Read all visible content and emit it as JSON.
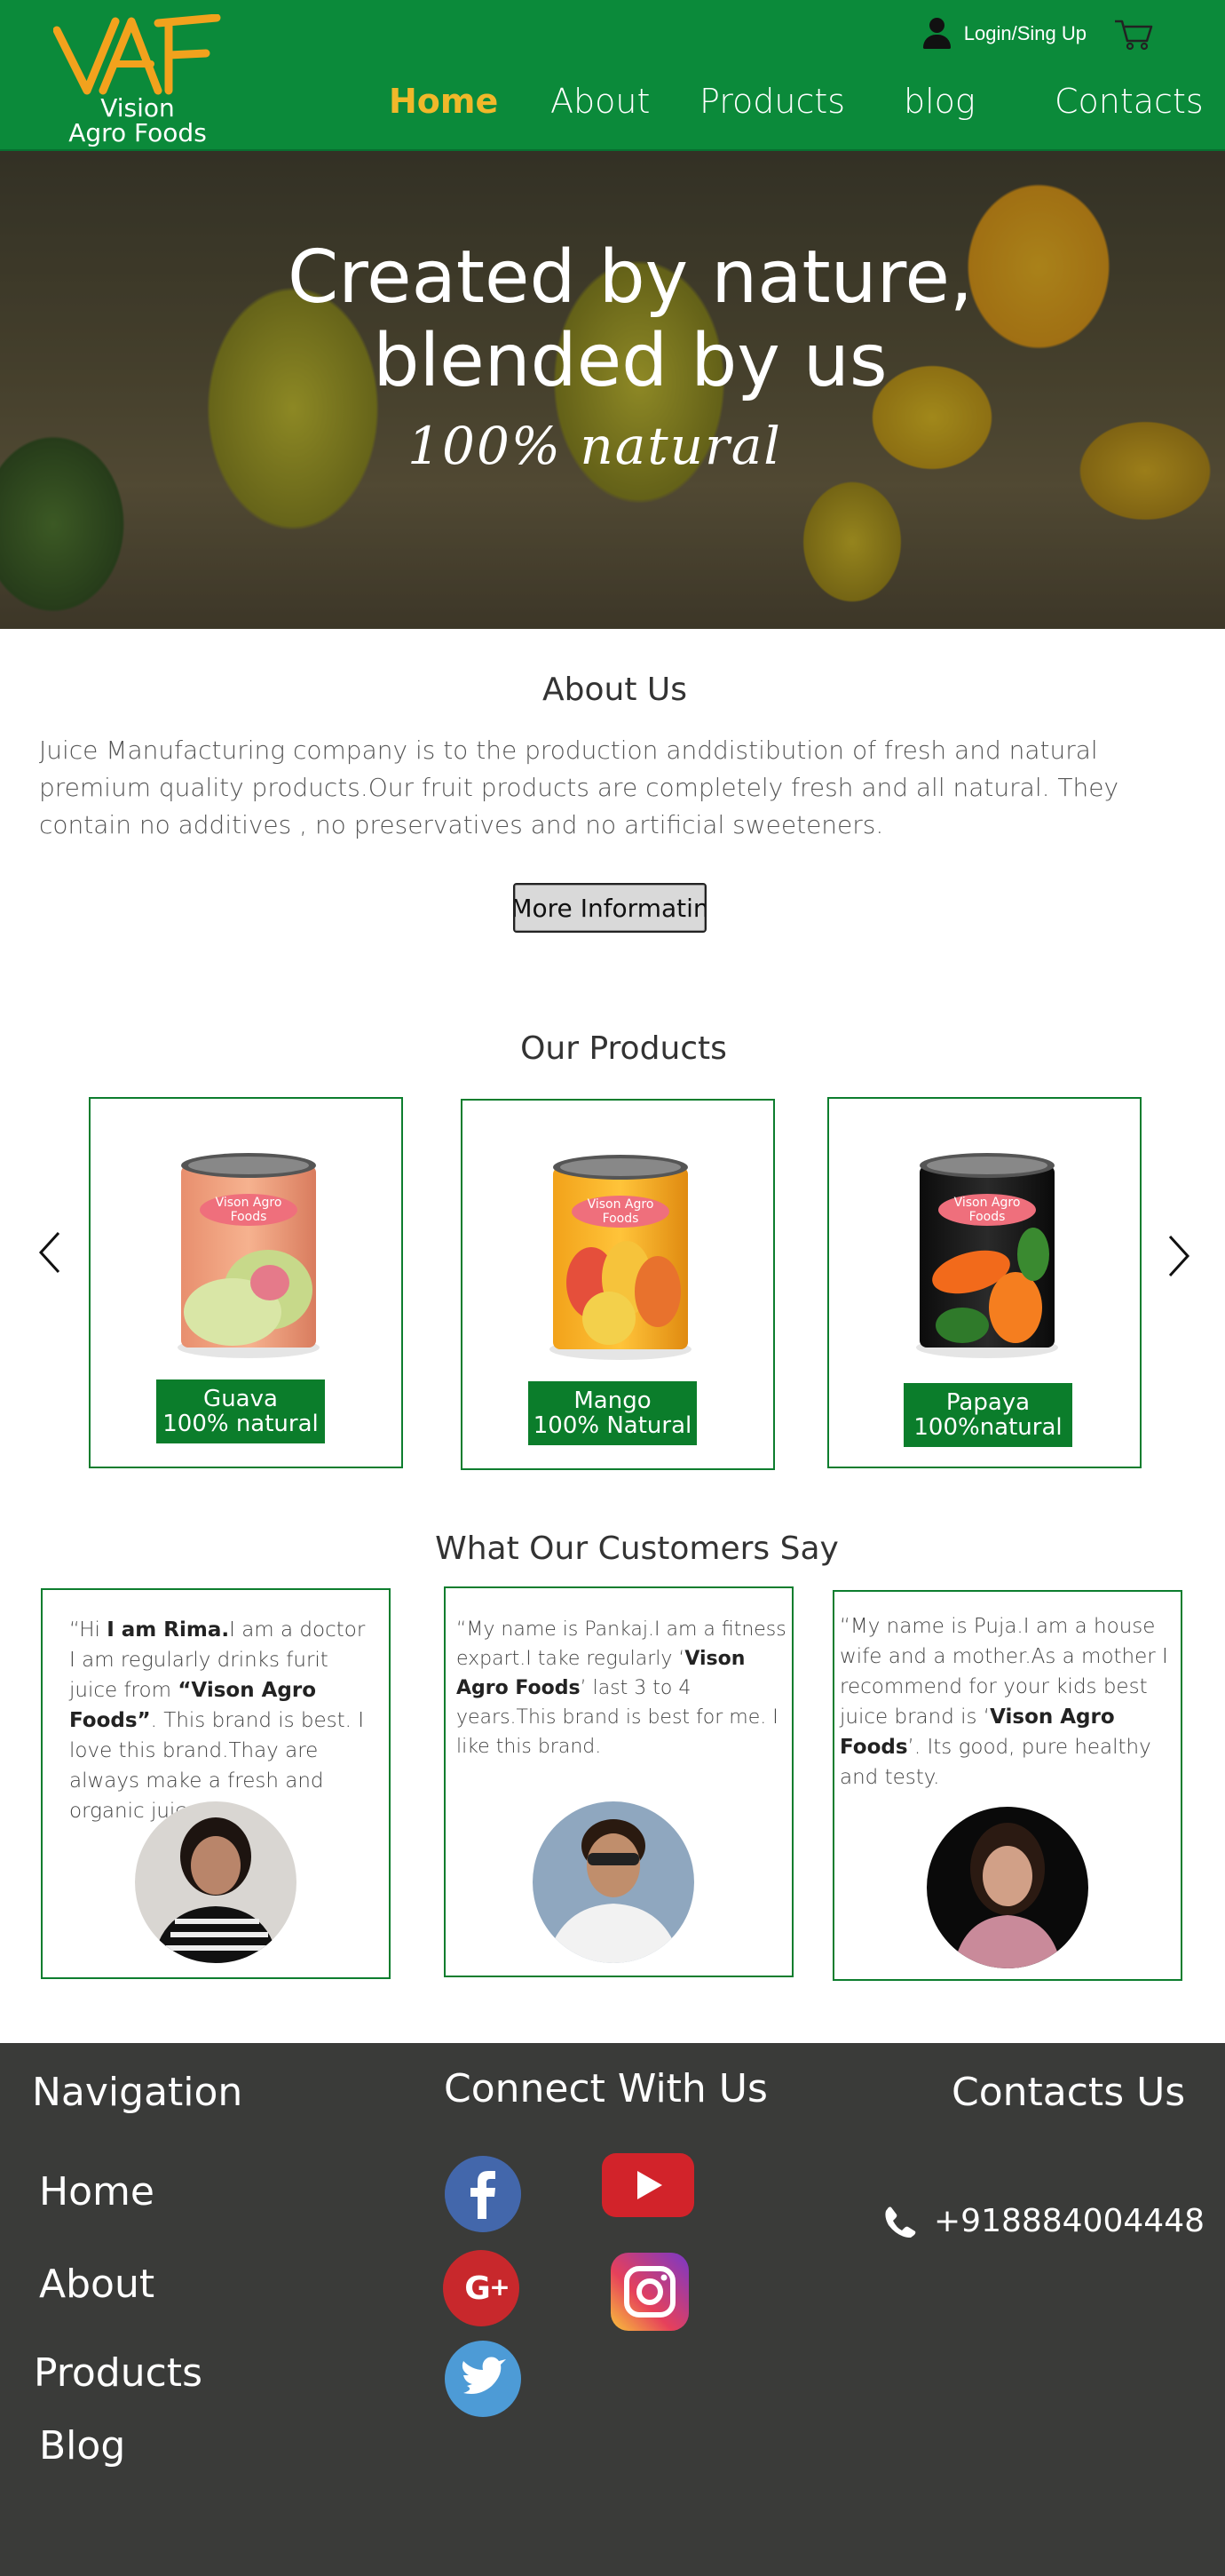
{
  "header": {
    "logo_text_line1": "Vision",
    "logo_text_line2": "Agro Foods",
    "login_label": "Login/Sing Up",
    "nav": [
      {
        "label": "Home",
        "active": true
      },
      {
        "label": "About",
        "active": false
      },
      {
        "label": "Products",
        "active": false
      },
      {
        "label": "blog",
        "active": false
      },
      {
        "label": "Contacts",
        "active": false
      }
    ]
  },
  "hero": {
    "title_line1": "Created by nature,",
    "title_line2": "blended by us",
    "subtitle": "100% natural"
  },
  "about": {
    "title": "About Us",
    "text": "Juice Manufacturing company is to the production anddistibution of fresh and natural premium quality products.Our fruit products  are completely fresh and all natural. They contain no additives , no preservatives and no artificial sweeteners.",
    "button_label": "More Informatin"
  },
  "products": {
    "title": "Our Products",
    "items": [
      {
        "can_label_line1": "Vison Agro",
        "can_label_line2": "Foods",
        "name": "Guava",
        "tagline": "100% natural"
      },
      {
        "can_label_line1": "Vison Agro",
        "can_label_line2": "Foods",
        "name": "Mango",
        "tagline": "100% Natural"
      },
      {
        "can_label_line1": "Vison Agro",
        "can_label_line2": "Foods",
        "name": "Papaya",
        "tagline": "100%natural"
      }
    ]
  },
  "testimonials": {
    "title": "What Our Customers Say",
    "items": [
      {
        "p1": "“Hi ",
        "b1": "I am Rima.",
        "p2": "I am a doctor I am regularly drinks furit juice from ",
        "b2": "“Vison Agro Foods”",
        "p3": ". This brand is best. I love  this brand.Thay are always make a fresh and organic juice.”"
      },
      {
        "p1": "“My name is Pankaj.I am  a fitness expart.I take regularly ‘",
        "b1": "Vison  Agro Foods",
        "p2": "’ last 3 to 4 years.This brand is best for me. I like this brand.",
        "b2": "",
        "p3": ""
      },
      {
        "p1": "“My name is Puja.I am a house wife and a mother.As a mother I recommend for your kids best juice brand is ‘",
        "b1": "Vison  Agro Foods",
        "p2": "’. Its good, pure healthy and testy.",
        "b2": "",
        "p3": ""
      }
    ]
  },
  "footer": {
    "nav_title": "Navigation",
    "nav_links": [
      "Home",
      "About",
      "Products",
      "Blog"
    ],
    "connect_title": "Connect With Us",
    "contacts_title": "Contacts Us",
    "phone": "+918884004448",
    "socials": [
      "facebook-icon",
      "youtube-icon",
      "google-plus-icon",
      "instagram-icon",
      "twitter-icon"
    ]
  },
  "colors": {
    "header_green": "#0b8a3a",
    "accent_orange": "#f0b82a",
    "card_border": "#0d7d2e",
    "footer_bg": "#3a3b39"
  }
}
